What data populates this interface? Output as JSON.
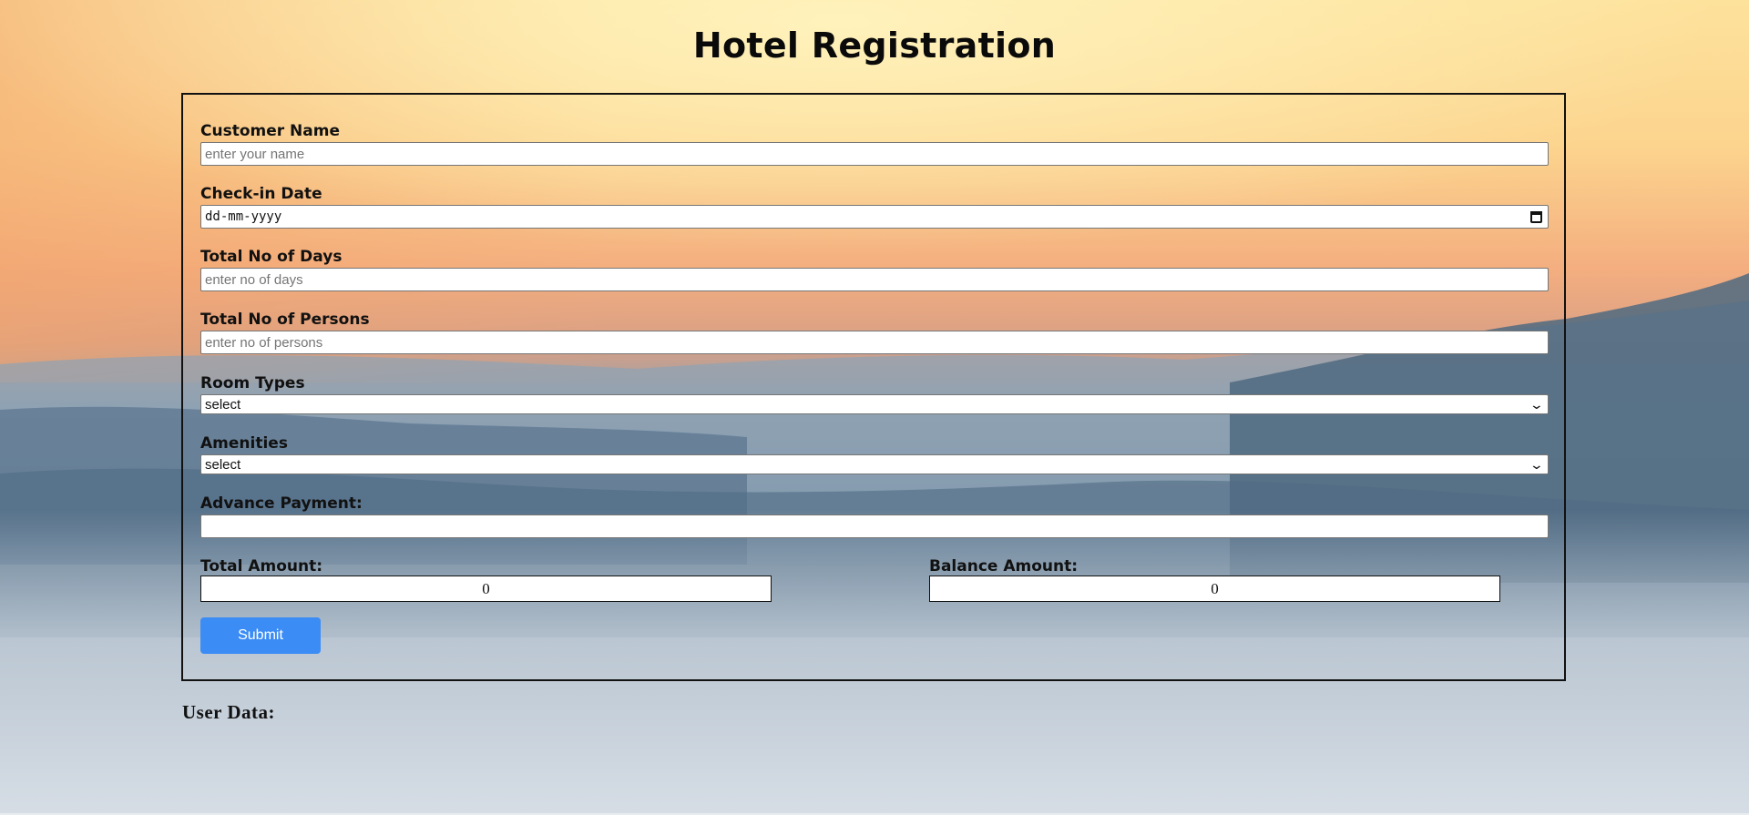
{
  "page": {
    "title": "Hotel Registration"
  },
  "form": {
    "customer_name": {
      "label": "Customer Name",
      "placeholder": "enter your name",
      "value": ""
    },
    "checkin_date": {
      "label": "Check-in Date",
      "placeholder": "dd-mm-yyyy",
      "value": ""
    },
    "total_days": {
      "label": "Total No of Days",
      "placeholder": "enter no of days",
      "value": ""
    },
    "total_persons": {
      "label": "Total No of Persons",
      "placeholder": "enter no of persons",
      "value": ""
    },
    "room_types": {
      "label": "Room Types",
      "selected": "select"
    },
    "amenities": {
      "label": "Amenities",
      "selected": "select"
    },
    "advance_payment": {
      "label": "Advance Payment:",
      "value": ""
    },
    "total_amount": {
      "label": "Total Amount:",
      "value": "0"
    },
    "balance_amount": {
      "label": "Balance Amount:",
      "value": "0"
    },
    "submit_label": "Submit"
  },
  "user_data": {
    "heading": "User Data:"
  },
  "colors": {
    "submit_button": "#3b8cf5",
    "sky_top": "#fde8a0",
    "sky_mid": "#f6b27c",
    "fog": "#c3ccd6"
  },
  "icons": {
    "calendar": "calendar-icon",
    "dropdown": "chevron-down-icon"
  }
}
